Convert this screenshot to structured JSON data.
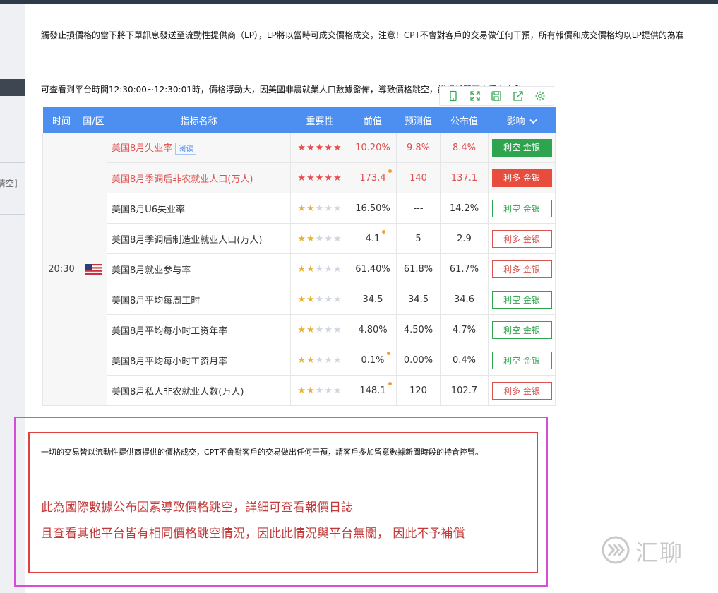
{
  "texts": {
    "notice1": "觸發止損價格的當下將下單訊息發送至流動性提供商（LP），LP將以當時可成交價格成交，注意！CPT不會對客戶的交易做任何干預，所有報價和成交價格均以LP提供的為准",
    "notice2": "可查看到平台時間12:30:00~12:30:01時，價格浮動大，因美國非農就業人口數據發佈，導致價格跳空，詳細新聞可查看右方數據",
    "left_clear": "清空]"
  },
  "table": {
    "headers": [
      "时间",
      "国/区",
      "指标名称",
      "重要性",
      "前值",
      "预测值",
      "公布值",
      "影响"
    ],
    "time": "20:30",
    "read_label": "阅读",
    "rows": [
      {
        "name": "美国8月失业率",
        "stars": 5,
        "prev": "10.20%",
        "forecast": "9.8%",
        "actual": "8.4%",
        "impact": "利空 金银",
        "impact_style": "green-filled",
        "highlight": true,
        "read": true,
        "dot": false
      },
      {
        "name": "美国8月季调后非农就业人口(万人)",
        "stars": 5,
        "prev": "173.4",
        "forecast": "140",
        "actual": "137.1",
        "impact": "利多 金银",
        "impact_style": "red-filled",
        "highlight": true,
        "read": false,
        "dot": true
      },
      {
        "name": "美国8月U6失业率",
        "stars": 2,
        "prev": "16.50%",
        "forecast": "---",
        "actual": "14.2%",
        "impact": "利空 金银",
        "impact_style": "green-outline",
        "highlight": false,
        "read": false,
        "dot": false
      },
      {
        "name": "美国8月季调后制造业就业人口(万人)",
        "stars": 2,
        "prev": "4.1",
        "forecast": "5",
        "actual": "2.9",
        "impact": "利多 金银",
        "impact_style": "red-outline",
        "highlight": false,
        "read": false,
        "dot": true
      },
      {
        "name": "美国8月就业参与率",
        "stars": 2,
        "prev": "61.40%",
        "forecast": "61.8%",
        "actual": "61.7%",
        "impact": "利多 金银",
        "impact_style": "red-outline",
        "highlight": false,
        "read": false,
        "dot": false
      },
      {
        "name": "美国8月平均每周工时",
        "stars": 2,
        "prev": "34.5",
        "forecast": "34.5",
        "actual": "34.6",
        "impact": "利空 金银",
        "impact_style": "green-outline",
        "highlight": false,
        "read": false,
        "dot": false
      },
      {
        "name": "美国8月平均每小时工资年率",
        "stars": 2,
        "prev": "4.80%",
        "forecast": "4.50%",
        "actual": "4.7%",
        "impact": "利空 金银",
        "impact_style": "green-outline",
        "highlight": false,
        "read": false,
        "dot": false
      },
      {
        "name": "美国8月平均每小时工资月率",
        "stars": 2,
        "prev": "0.1%",
        "forecast": "0.00%",
        "actual": "0.4%",
        "impact": "利空 金银",
        "impact_style": "green-outline",
        "highlight": false,
        "read": false,
        "dot": true
      },
      {
        "name": "美国8月私人非农就业人数(万人)",
        "stars": 2,
        "prev": "148.1",
        "forecast": "120",
        "actual": "102.7",
        "impact": "利多 金银",
        "impact_style": "red-outline",
        "highlight": false,
        "read": false,
        "dot": true
      }
    ]
  },
  "notes": {
    "small": "一切的交易皆以流動性提供商提供的價格成交，CPT不會對客戶的交易做出任何干預，請客戶多加留意數據新聞時段的持倉控管。",
    "red1": "此為國際數據公布因素導致價格跳空，詳細可查看報價日誌",
    "red2": "且查看其他平台皆有相同價格跳空情況，因此此情況與平台無關， 因此不予補償"
  },
  "watermark": {
    "text": "汇聊",
    "icon": "chevron-logo-icon"
  },
  "colors": {
    "header_blue": "#4c8ff0",
    "green": "#2fa44f",
    "red": "#e74c3c",
    "highlight_text": "#e05050",
    "note_red": "#c23a3a"
  }
}
